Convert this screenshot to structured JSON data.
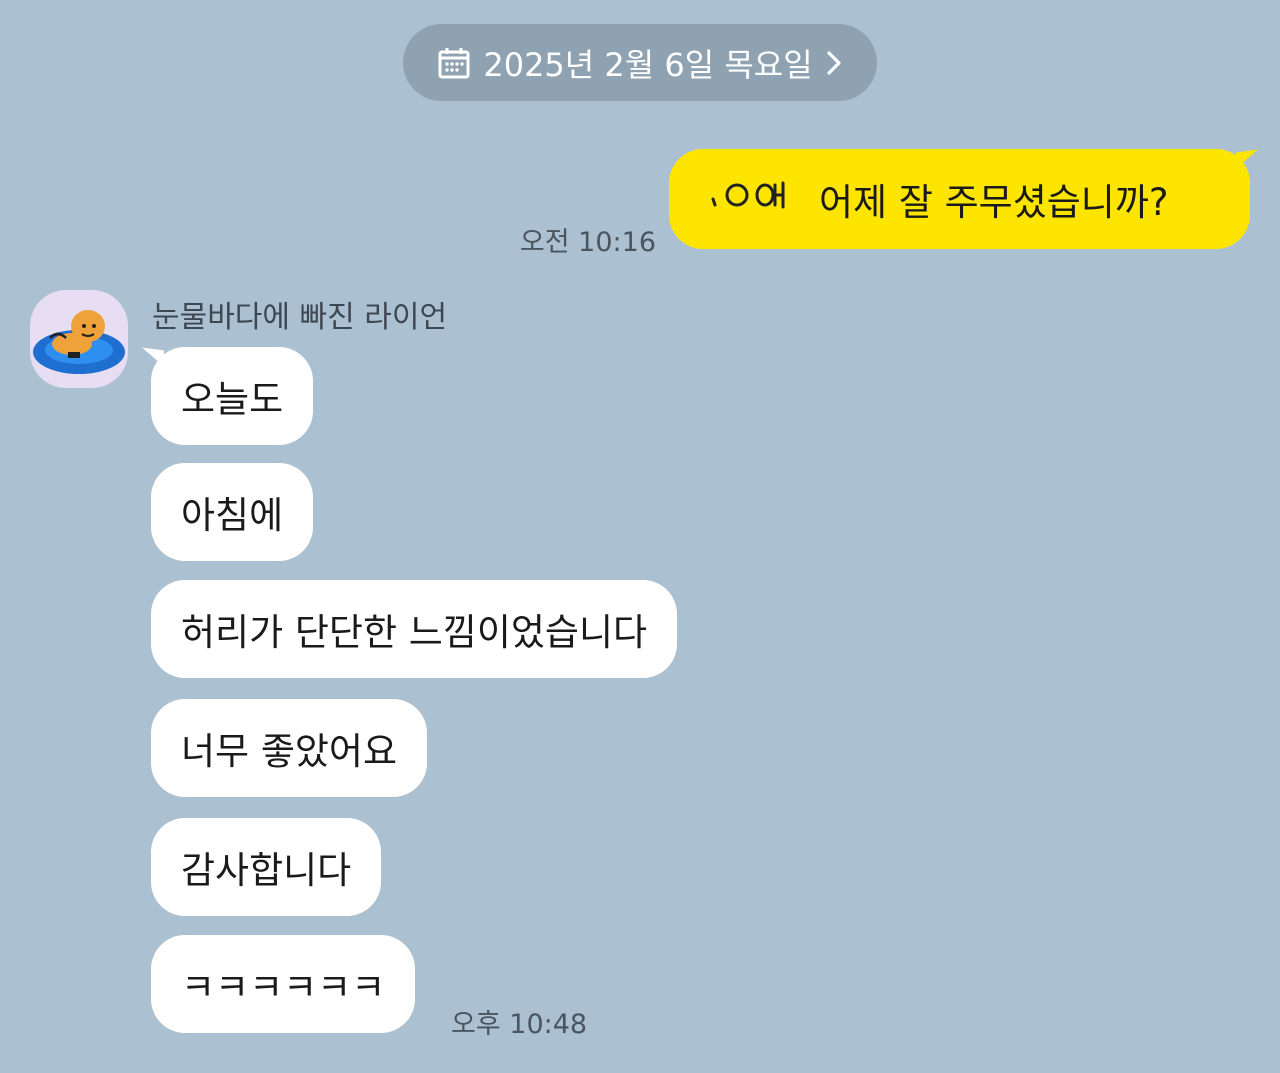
{
  "chat": {
    "date_label": "2025년 2월 6일 목요일",
    "sent": {
      "text": "어제 잘 주무셨습니까?",
      "time": "오전 10:16"
    },
    "received": {
      "sender_name": "눈물바다에 빠진 라이언",
      "messages": [
        "오늘도",
        "아침에",
        "허리가 단단한 느낌이었습니다",
        "너무 좋았어요",
        "감사합니다",
        "ㅋㅋㅋㅋㅋㅋ"
      ],
      "time": "오후 10:48"
    }
  },
  "colors": {
    "background": "#abc1d1",
    "my_bubble": "#fee500",
    "their_bubble": "#ffffff",
    "date_pill": "#8fa2b1"
  },
  "icons": {
    "calendar": "calendar-icon",
    "chevron": "chevron-right-icon",
    "avatar": "lion-in-tears-avatar"
  }
}
